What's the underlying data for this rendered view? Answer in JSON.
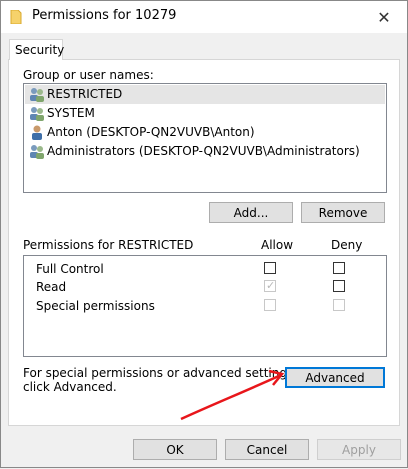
{
  "window": {
    "title": "Permissions for 10279",
    "close_glyph": "✕"
  },
  "tab": {
    "label": "Security"
  },
  "group_label": "Group or user names:",
  "users": [
    {
      "name": "RESTRICTED",
      "icon": "group-icon"
    },
    {
      "name": "SYSTEM",
      "icon": "group-icon"
    },
    {
      "name": "Anton (DESKTOP-QN2VUVB\\Anton)",
      "icon": "user-icon"
    },
    {
      "name": "Administrators (DESKTOP-QN2VUVB\\Administrators)",
      "icon": "group-icon"
    }
  ],
  "buttons": {
    "add": "Add...",
    "remove": "Remove",
    "advanced": "Advanced",
    "ok": "OK",
    "cancel": "Cancel",
    "apply": "Apply"
  },
  "permissions": {
    "header": "Permissions for RESTRICTED",
    "allow_header": "Allow",
    "deny_header": "Deny",
    "rows": [
      {
        "name": "Full Control",
        "allow": false,
        "deny": false,
        "allow_disabled": false,
        "deny_disabled": false
      },
      {
        "name": "Read",
        "allow": true,
        "deny": false,
        "allow_disabled": true,
        "deny_disabled": false
      },
      {
        "name": "Special permissions",
        "allow": false,
        "deny": false,
        "allow_disabled": true,
        "deny_disabled": true
      }
    ]
  },
  "advanced_text_line1": "For special permissions or advanced settings,",
  "advanced_text_line2": "click Advanced.",
  "colors": {
    "accent": "#0078d7",
    "annotation_arrow": "#e8161b",
    "selected_row": "#e5e5e5"
  }
}
